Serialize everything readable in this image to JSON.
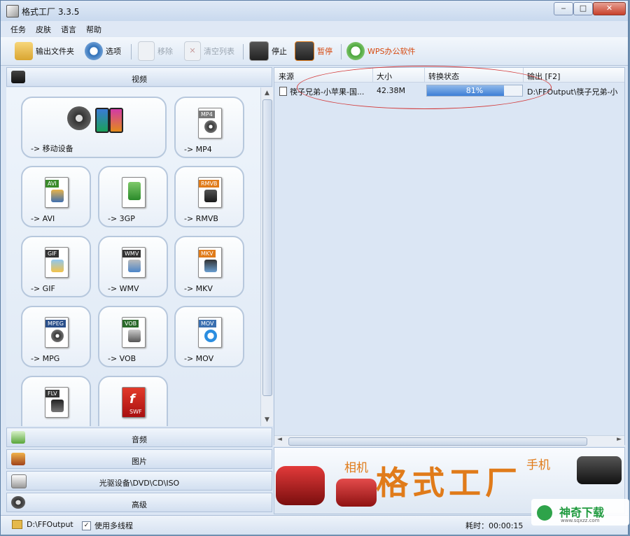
{
  "window": {
    "title": "格式工厂 3.3.5"
  },
  "menu": [
    "任务",
    "皮肤",
    "语言",
    "帮助"
  ],
  "toolbar": {
    "output_folder": "输出文件夹",
    "options": "选项",
    "remove": "移除",
    "clear_list": "清空列表",
    "stop": "停止",
    "pause": "暂停",
    "wps": "WPS办公软件"
  },
  "left_panel": {
    "video_header": "视频",
    "tiles": [
      {
        "label": "-> 移动设备",
        "tag": ""
      },
      {
        "label": "-> MP4",
        "tag": "MP4"
      },
      {
        "label": "-> AVI",
        "tag": "AVI"
      },
      {
        "label": "-> 3GP",
        "tag": ""
      },
      {
        "label": "-> RMVB",
        "tag": "RMVB"
      },
      {
        "label": "-> GIF",
        "tag": "GIF"
      },
      {
        "label": "-> WMV",
        "tag": "WMV"
      },
      {
        "label": "-> MKV",
        "tag": "MKV"
      },
      {
        "label": "-> MPG",
        "tag": "MPEG"
      },
      {
        "label": "-> VOB",
        "tag": "VOB"
      },
      {
        "label": "-> MOV",
        "tag": "MOV"
      },
      {
        "label": "",
        "tag": "FLV"
      },
      {
        "label": "",
        "tag": "SWF"
      }
    ],
    "categories": [
      "音频",
      "图片",
      "光驱设备\\DVD\\CD\\ISO",
      "高级"
    ]
  },
  "task_list": {
    "columns": [
      "来源",
      "大小",
      "转换状态",
      "输出 [F2]"
    ],
    "rows": [
      {
        "source": "筷子兄弟-小苹果-国...",
        "size": "42.38M",
        "progress": 81,
        "progress_label": "81%",
        "output": "D:\\FFOutput\\筷子兄弟-小"
      }
    ]
  },
  "banner": {
    "title": "格式工厂",
    "left_word": "相机",
    "right_word": "手机"
  },
  "status": {
    "output_path": "D:\\FFOutput",
    "multithread_label": "使用多线程",
    "multithread_checked": "✓",
    "elapsed": "耗时：00:00:15"
  },
  "watermark": {
    "brand": "神奇下载",
    "url": "www.sqxzz.com"
  },
  "colors": {
    "accent": "#3d7fd6",
    "annotation": "#d23a3a",
    "banner_text": "#e07b1a"
  }
}
